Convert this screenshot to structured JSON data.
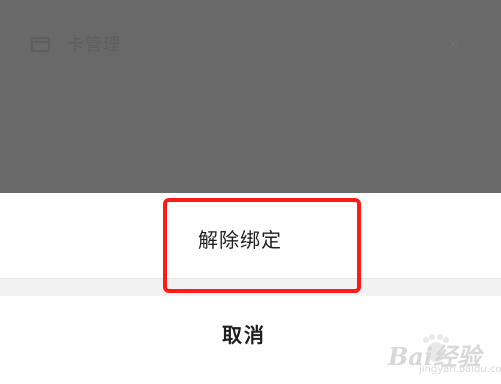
{
  "header": {
    "icon": "card-icon",
    "title": "卡管理",
    "close_icon": "close-icon",
    "close_glyph": "×"
  },
  "action_sheet": {
    "unbind_label": "解除绑定",
    "cancel_label": "取消"
  },
  "annotation": {
    "highlight_color": "#ff1a1a"
  },
  "watermark": {
    "text": "Bai经验",
    "subtext": "jingyan.baidu.com"
  },
  "colors": {
    "overlay": "#696969",
    "sheet_background": "#ffffff",
    "divider": "#f2f2f2",
    "text": "#1f1f1f"
  }
}
